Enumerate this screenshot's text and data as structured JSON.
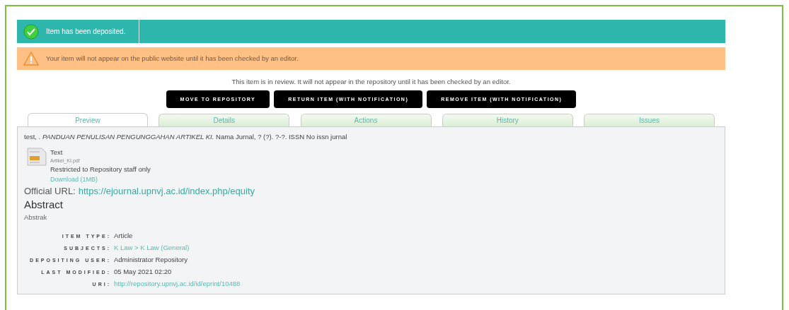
{
  "success_message": "Item has been deposited.",
  "warning_message": "Your item will not appear on the public website until it has been checked by an editor.",
  "review_note": "This item is in review. It will not appear in the repository until it has been checked by an editor.",
  "actions": [
    "MOVE TO REPOSITORY",
    "RETURN ITEM (WITH NOTIFICATION)",
    "REMOVE ITEM (WITH NOTIFICATION)"
  ],
  "tabs": [
    {
      "label": "Preview",
      "selected": true
    },
    {
      "label": "Details",
      "selected": false
    },
    {
      "label": "Actions",
      "selected": false
    },
    {
      "label": "History",
      "selected": false
    },
    {
      "label": "Issues",
      "selected": false
    }
  ],
  "citation": "test, . *PANDUAN PENULISAN PENGUNGGAHAN ARTIKEL KI.* Nama Jurnal, ? (?). ?-?. ISSN No issn jurnal",
  "document": {
    "format": "Text",
    "filename": "Artikel_KI.pdf",
    "access": "Restricted to Repository staff only",
    "download": "Download (1MB)"
  },
  "official_url": {
    "label": "Official URL:",
    "url": "https://ejournal.upnvj.ac.id/index.php/equity"
  },
  "abstract": {
    "heading": "Abstract",
    "text": "Abstrak"
  },
  "details": [
    {
      "label": "ITEM TYPE:",
      "value": "Article",
      "kind": "text"
    },
    {
      "label": "SUBJECTS:",
      "value": "K Law > K Law (General)",
      "kind": "link"
    },
    {
      "label": "DEPOSITING USER:",
      "value": "Administrator Repository",
      "kind": "text"
    },
    {
      "label": "LAST MODIFIED:",
      "value": "05 May 2021 02:20",
      "kind": "text"
    },
    {
      "label": "URI:",
      "value": "http://repository.upnvj.ac.id/id/eprint/10488",
      "kind": "link"
    }
  ]
}
